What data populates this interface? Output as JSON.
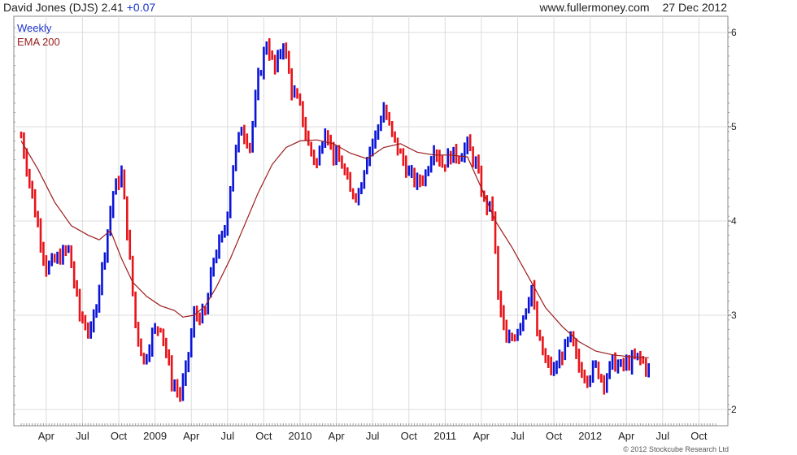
{
  "header": {
    "ticker_name": "David Jones (DJS)",
    "price": "2.41",
    "change": "+0.07",
    "site": "www.fullermoney.com",
    "date": "27 Dec 2012"
  },
  "legend": {
    "weekly": "Weekly",
    "ema": "EMA 200"
  },
  "footer": "© 2012 Stockcube Research Ltd",
  "colors": {
    "up": "#0a14d8",
    "down": "#e8141a",
    "ema": "#9b1c1c",
    "grid": "#dcdcdc"
  },
  "chart_data": {
    "type": "line",
    "title": "David Jones (DJS) 2.41 +0.07",
    "xlabel": "",
    "ylabel": "",
    "ylim": [
      1.9,
      6.1
    ],
    "xlim": [
      0,
      225
    ],
    "y_ticks": [
      2,
      3,
      4,
      5,
      6
    ],
    "x_ticks": [
      {
        "label": "Apr",
        "x": 9
      },
      {
        "label": "Jul",
        "x": 22
      },
      {
        "label": "Oct",
        "x": 35
      },
      {
        "label": "2009",
        "x": 48
      },
      {
        "label": "Apr",
        "x": 61
      },
      {
        "label": "Jul",
        "x": 74
      },
      {
        "label": "Oct",
        "x": 87
      },
      {
        "label": "2010",
        "x": 100
      },
      {
        "label": "Apr",
        "x": 113
      },
      {
        "label": "Jul",
        "x": 126
      },
      {
        "label": "Oct",
        "x": 139
      },
      {
        "label": "2011",
        "x": 152
      },
      {
        "label": "Apr",
        "x": 165
      },
      {
        "label": "Jul",
        "x": 178
      },
      {
        "label": "Oct",
        "x": 191
      },
      {
        "label": "2012",
        "x": 204
      },
      {
        "label": "Apr",
        "x": 217
      },
      {
        "label": "Jul",
        "x": 230
      },
      {
        "label": "Oct",
        "x": 243
      }
    ],
    "series": [
      {
        "name": "Weekly",
        "style": "bars",
        "x": [
          0,
          225
        ],
        "anchors": [
          [
            0,
            4.9
          ],
          [
            5,
            4.1
          ],
          [
            9,
            3.5
          ],
          [
            13,
            3.6
          ],
          [
            17,
            3.7
          ],
          [
            21,
            3.0
          ],
          [
            25,
            2.8
          ],
          [
            29,
            3.5
          ],
          [
            33,
            4.3
          ],
          [
            36,
            4.5
          ],
          [
            38,
            3.9
          ],
          [
            41,
            2.9
          ],
          [
            44,
            2.5
          ],
          [
            47,
            2.8
          ],
          [
            50,
            2.9
          ],
          [
            54,
            2.3
          ],
          [
            57,
            2.15
          ],
          [
            59,
            2.4
          ],
          [
            62,
            3.0
          ],
          [
            66,
            3.0
          ],
          [
            69,
            3.6
          ],
          [
            73,
            3.9
          ],
          [
            76,
            4.6
          ],
          [
            79,
            5.0
          ],
          [
            82,
            4.8
          ],
          [
            85,
            5.5
          ],
          [
            88,
            5.9
          ],
          [
            91,
            5.6
          ],
          [
            94,
            5.9
          ],
          [
            97,
            5.4
          ],
          [
            100,
            5.2
          ],
          [
            103,
            4.8
          ],
          [
            106,
            4.6
          ],
          [
            109,
            5.0
          ],
          [
            112,
            4.7
          ],
          [
            115,
            4.6
          ],
          [
            118,
            4.3
          ],
          [
            121,
            4.3
          ],
          [
            124,
            4.7
          ],
          [
            127,
            4.9
          ],
          [
            130,
            5.2
          ],
          [
            133,
            4.9
          ],
          [
            136,
            4.7
          ],
          [
            139,
            4.5
          ],
          [
            142,
            4.4
          ],
          [
            145,
            4.5
          ],
          [
            148,
            4.8
          ],
          [
            151,
            4.6
          ],
          [
            154,
            4.7
          ],
          [
            157,
            4.7
          ],
          [
            160,
            4.8
          ],
          [
            163,
            4.6
          ],
          [
            166,
            4.2
          ],
          [
            169,
            4.1
          ],
          [
            171,
            3.2
          ],
          [
            174,
            2.7
          ],
          [
            177,
            2.8
          ],
          [
            180,
            3.0
          ],
          [
            183,
            3.3
          ],
          [
            185,
            2.8
          ],
          [
            188,
            2.5
          ],
          [
            191,
            2.4
          ],
          [
            194,
            2.6
          ],
          [
            197,
            2.75
          ],
          [
            200,
            2.45
          ],
          [
            203,
            2.35
          ],
          [
            206,
            2.45
          ],
          [
            209,
            2.3
          ],
          [
            212,
            2.5
          ],
          [
            215,
            2.45
          ],
          [
            218,
            2.5
          ],
          [
            221,
            2.55
          ],
          [
            223,
            2.5
          ],
          [
            225,
            2.4
          ]
        ]
      },
      {
        "name": "EMA 200",
        "style": "line",
        "points": [
          [
            0,
            4.85
          ],
          [
            6,
            4.55
          ],
          [
            12,
            4.2
          ],
          [
            18,
            3.95
          ],
          [
            24,
            3.85
          ],
          [
            28,
            3.8
          ],
          [
            32,
            3.9
          ],
          [
            36,
            3.6
          ],
          [
            40,
            3.35
          ],
          [
            45,
            3.2
          ],
          [
            50,
            3.1
          ],
          [
            55,
            3.05
          ],
          [
            58,
            2.98
          ],
          [
            62,
            3.0
          ],
          [
            66,
            3.1
          ],
          [
            70,
            3.3
          ],
          [
            75,
            3.6
          ],
          [
            80,
            3.95
          ],
          [
            85,
            4.3
          ],
          [
            90,
            4.6
          ],
          [
            95,
            4.78
          ],
          [
            100,
            4.85
          ],
          [
            106,
            4.86
          ],
          [
            112,
            4.82
          ],
          [
            118,
            4.72
          ],
          [
            124,
            4.66
          ],
          [
            130,
            4.78
          ],
          [
            136,
            4.82
          ],
          [
            142,
            4.73
          ],
          [
            148,
            4.7
          ],
          [
            154,
            4.7
          ],
          [
            160,
            4.68
          ],
          [
            165,
            4.35
          ],
          [
            170,
            4.0
          ],
          [
            176,
            3.72
          ],
          [
            182,
            3.4
          ],
          [
            188,
            3.08
          ],
          [
            194,
            2.88
          ],
          [
            200,
            2.72
          ],
          [
            206,
            2.62
          ],
          [
            212,
            2.58
          ],
          [
            218,
            2.56
          ],
          [
            222,
            2.55
          ],
          [
            225,
            2.55
          ]
        ]
      }
    ],
    "grid": true,
    "legend_position": "top-left"
  }
}
